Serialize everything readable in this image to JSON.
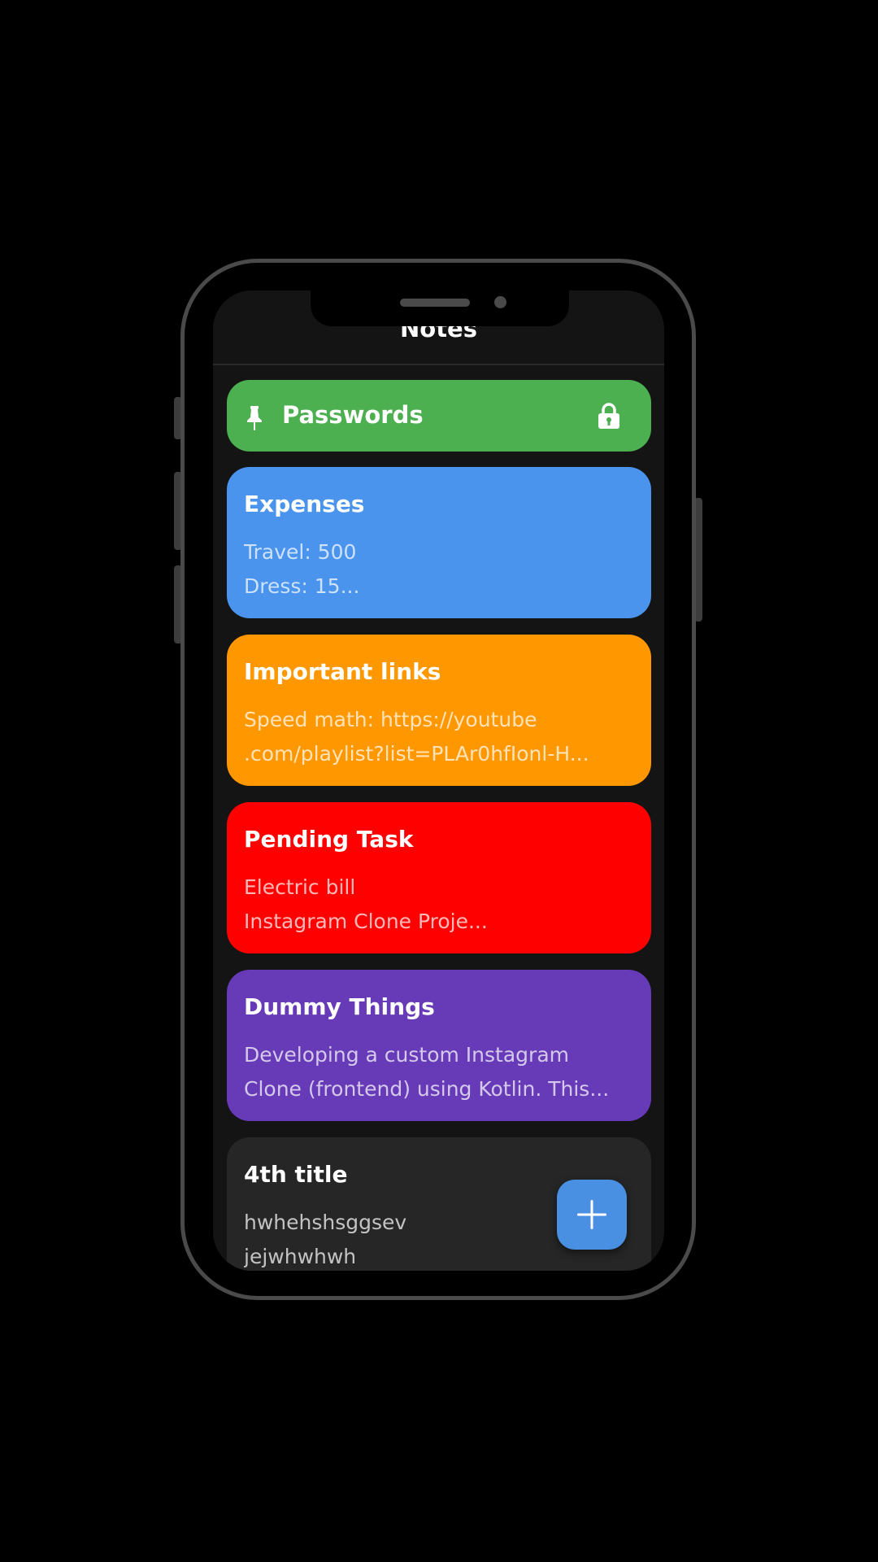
{
  "app": {
    "title": "Notes"
  },
  "colors": {
    "background": "#000000",
    "screen": "#141414",
    "fab": "#4a90e2"
  },
  "pinned_note": {
    "title": "Passwords",
    "color": "#4caf50",
    "pin_icon": "pin-icon",
    "lock_icon": "lock-icon"
  },
  "notes": [
    {
      "title": "Expenses",
      "lines": [
        "Travel: 500",
        "Dress: 15..."
      ],
      "color": "#4a94ee"
    },
    {
      "title": "Important links",
      "lines": [
        "Speed math: https://youtube",
        ".com/playlist?list=PLAr0hfIonl-H..."
      ],
      "color": "#ff9800"
    },
    {
      "title": "Pending Task",
      "lines": [
        "Electric bill",
        "Instagram Clone Proje..."
      ],
      "color": "#ff0000"
    },
    {
      "title": "Dummy Things",
      "lines": [
        "Developing a custom Instagram",
        "Clone (frontend) using Kotlin. This..."
      ],
      "color": "#673ab7"
    },
    {
      "title": "4th title",
      "lines": [
        "hwhehshsggsev",
        "jejwhwhwh"
      ],
      "color": "#262626"
    }
  ],
  "fab": {
    "icon": "plus-icon"
  }
}
